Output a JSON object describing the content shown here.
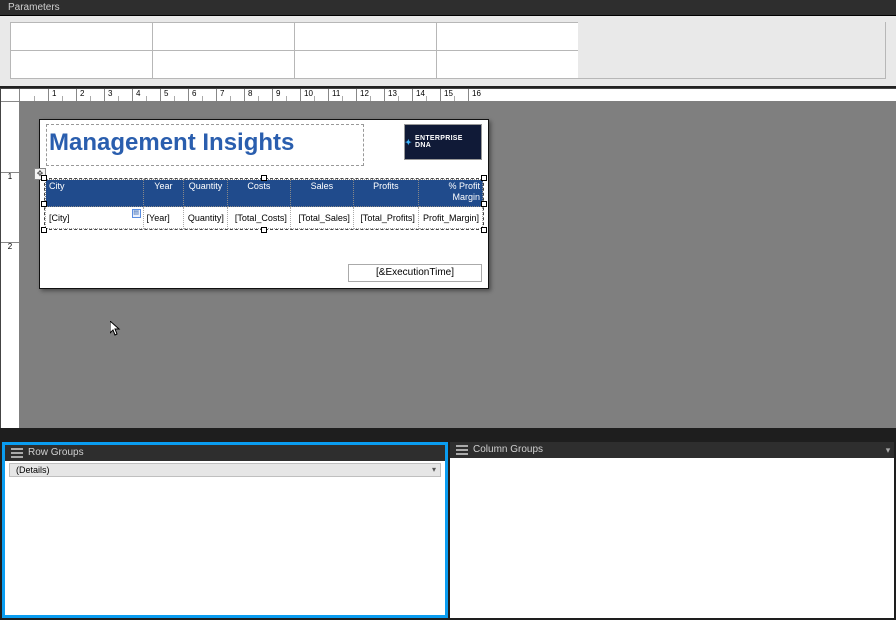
{
  "panels": {
    "parameters_title": "Parameters",
    "row_groups_title": "Row Groups",
    "column_groups_title": "Column Groups",
    "row_group_item": "(Details)"
  },
  "ruler": {
    "ticks": [
      "1",
      "2",
      "3",
      "4",
      "5",
      "6",
      "7",
      "8",
      "9",
      "10",
      "11",
      "12",
      "13",
      "14",
      "15",
      "16"
    ],
    "vticks": [
      "1",
      "2"
    ]
  },
  "report": {
    "title": "Management Insights",
    "logo_text": "ENTERPRISE DNA",
    "footer": "[&ExecutionTime]"
  },
  "tablix": {
    "columns": [
      {
        "header": "City",
        "value": "[City]"
      },
      {
        "header": "Year",
        "value": "[Year]"
      },
      {
        "header": "Quantity",
        "value": "Quantity]"
      },
      {
        "header": "Costs",
        "value": "[Total_Costs]"
      },
      {
        "header": "Sales",
        "value": "[Total_Sales]"
      },
      {
        "header": "Profits",
        "value": "[Total_Profits]"
      },
      {
        "header_line1": "% Profit",
        "header_line2": "Margin",
        "value": "Profit_Margin]"
      }
    ]
  },
  "colors": {
    "header_blue": "#204b8c",
    "title_blue": "#2a5eae",
    "selection_blue": "#0a9df1"
  }
}
